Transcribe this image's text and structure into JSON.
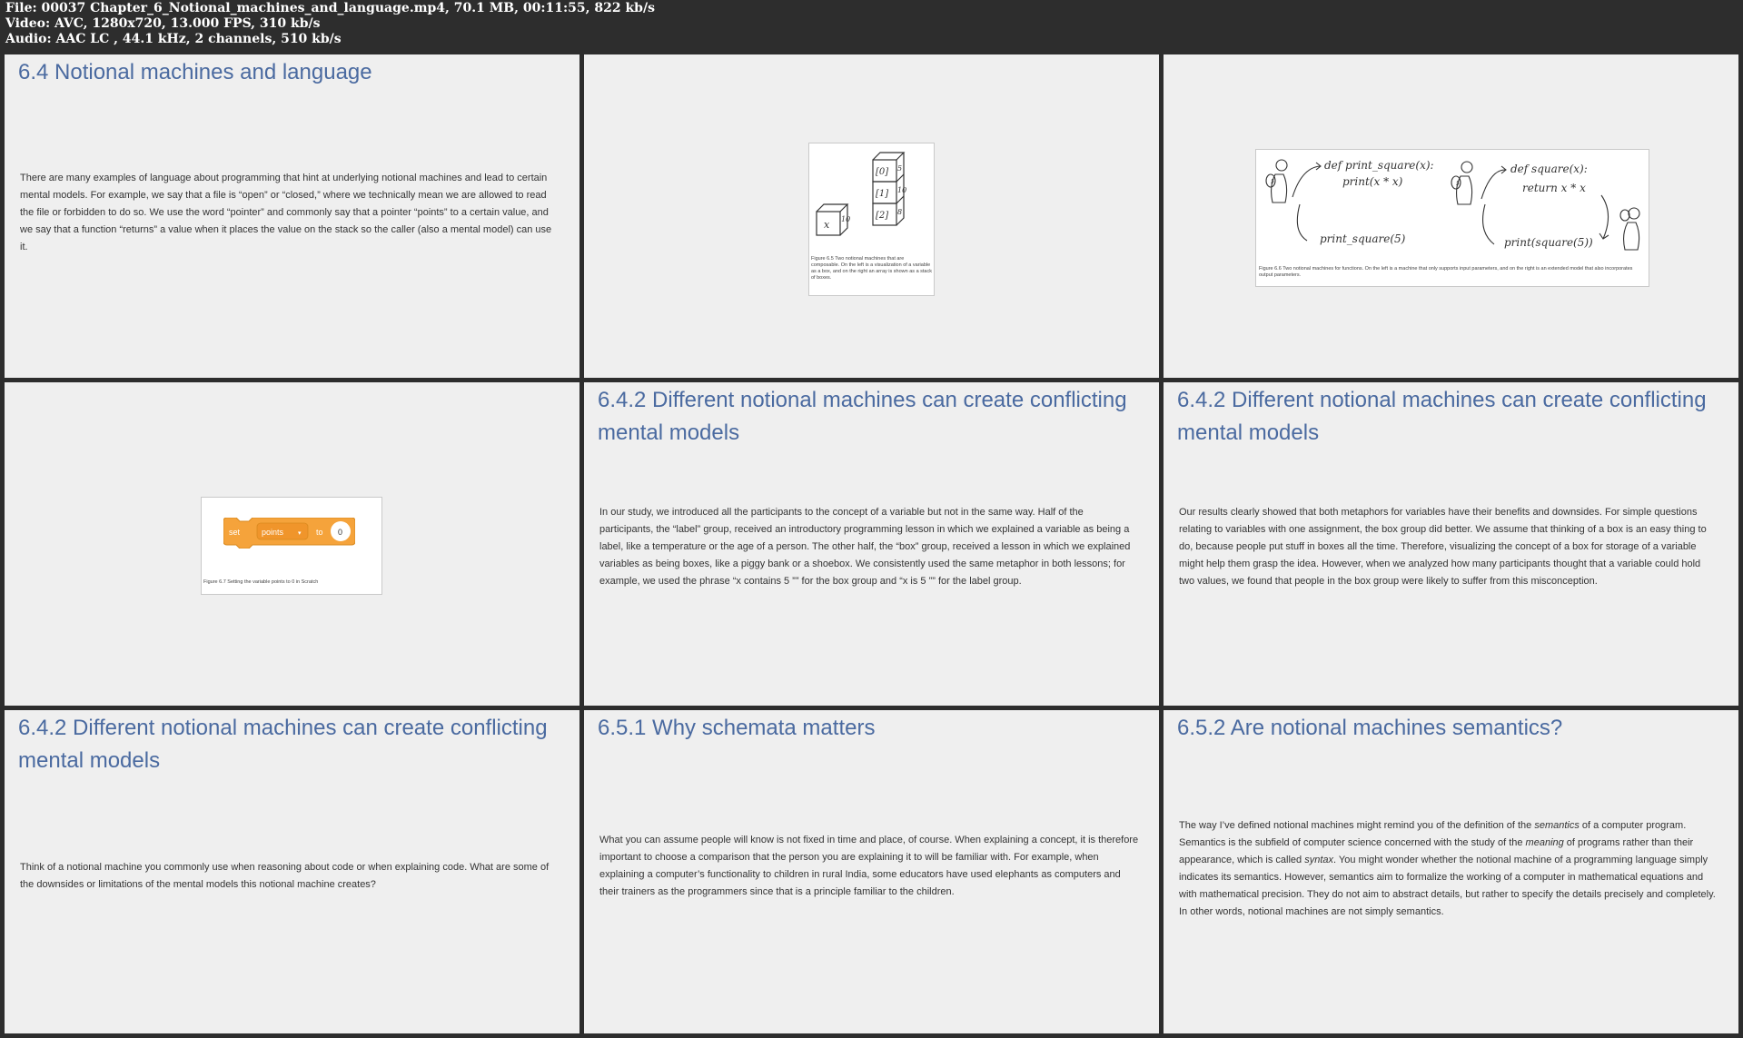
{
  "header": {
    "file_line": "File: 00037 Chapter_6_Notional_machines_and_language.mp4, 70.1 MB, 00:11:55, 822 kb/s",
    "video_line": "Video: AVC, 1280x720, 13.000 FPS, 310 kb/s",
    "audio_line": "Audio: AAC LC , 44.1 kHz, 2 channels, 510 kb/s"
  },
  "cells": [
    {
      "title": "6.4 Notional machines and language",
      "body": "There are many examples of language about programming that hint at underlying notional machines and lead to certain mental models. For example, we say that a file is “open” or “closed,” where we technically mean we are allowed to read the file or forbidden to do so. We use the word “pointer” and commonly say that a pointer “points” to a certain value, and we say that a function “returns” a value when it places the value on the stack so the caller (also a mental model) can use it."
    },
    {
      "figure": {
        "caption": "Figure 6.5 Two notional machines that are composable. On the left is a visualization of a variable as a box, and on the right an array is shown as a stack of boxes.",
        "box_x": "x",
        "box_x_value": "10",
        "stack_labels": [
          "[0]",
          "[1]",
          "[2]"
        ],
        "stack_values": [
          "5",
          "10",
          "8"
        ]
      }
    },
    {
      "figure": {
        "caption": "Figure 6.6 Two notional machines for functions. On the left is a machine that only supports input parameters, and on the right is an extended model that also incorporates output parameters.",
        "left_def": "def print_square(x):",
        "left_body": "print(x * x)",
        "left_call": "print_square(5)",
        "right_def": "def square(x):",
        "right_body": "return x * x",
        "right_call": "print(square(5))",
        "ball_label": "5"
      }
    },
    {
      "figure": {
        "caption": "Figure 6.7 Setting the variable points to 0 in Scratch",
        "block_set": "set",
        "block_var": "points",
        "block_to": "to",
        "block_value": "0"
      }
    },
    {
      "title": "6.4.2 Different notional machines can create conflicting mental models",
      "body": "In our study, we introduced all the participants to the concept of a variable but not in the same way. Half of the participants, the “label” group, received an introductory programming lesson in which we explained a variable as being a label, like a temperature or the age of a person. The other half, the “box” group, received a lesson in which we explained variables as being boxes, like a piggy bank or a shoebox. We consistently used the same metaphor in both lessons; for example, we used the phrase “x contains 5 ”” for the box group and “x is 5 ”” for the label group."
    },
    {
      "title": "6.4.2 Different notional machines can create conflicting mental models",
      "body": "Our results clearly showed that both metaphors for variables have their benefits and downsides. For simple questions relating to variables with one assignment, the box group did better. We assume that thinking of a box is an easy thing to do, because people put stuff in boxes all the time. Therefore, visualizing the concept of a box for storage of a variable might help them grasp the idea. However, when we analyzed how many participants thought that a variable could hold two values, we found that people in the box group were likely to suffer from this misconception."
    },
    {
      "title": "6.4.2 Different notional machines can create conflicting mental models",
      "body": "Think of a notional machine you commonly use when reasoning about code or when explaining code. What are some of the downsides or limitations of the mental models this notional machine creates?"
    },
    {
      "title": "6.5.1 Why schemata matters",
      "body": "What you can assume people will know is not fixed in time and place, of course. When explaining a concept, it is therefore important to choose a comparison that the person you are explaining it to will be familiar with. For example, when explaining a computer’s functionality to children in rural India, some educators have used elephants as computers and their trainers as the programmers since that is a principle familiar to the children."
    },
    {
      "title": "6.5.2 Are notional machines semantics?",
      "body_parts": [
        "The way I’ve defined notional machines might remind you of the definition of the ",
        "semantics",
        " of a computer program. Semantics is the subfield of computer science concerned with the study of the ",
        "meaning",
        " of programs rather than their appearance, which is called ",
        "syntax",
        ". You might wonder whether the notional machine of a programming language simply indicates its semantics. However, semantics aim to formalize the working of a computer in mathematical equations and with mathematical precision. They do not aim to abstract details, but rather to specify the details precisely and completely. In other words, notional machines are not simply semantics."
      ]
    }
  ]
}
